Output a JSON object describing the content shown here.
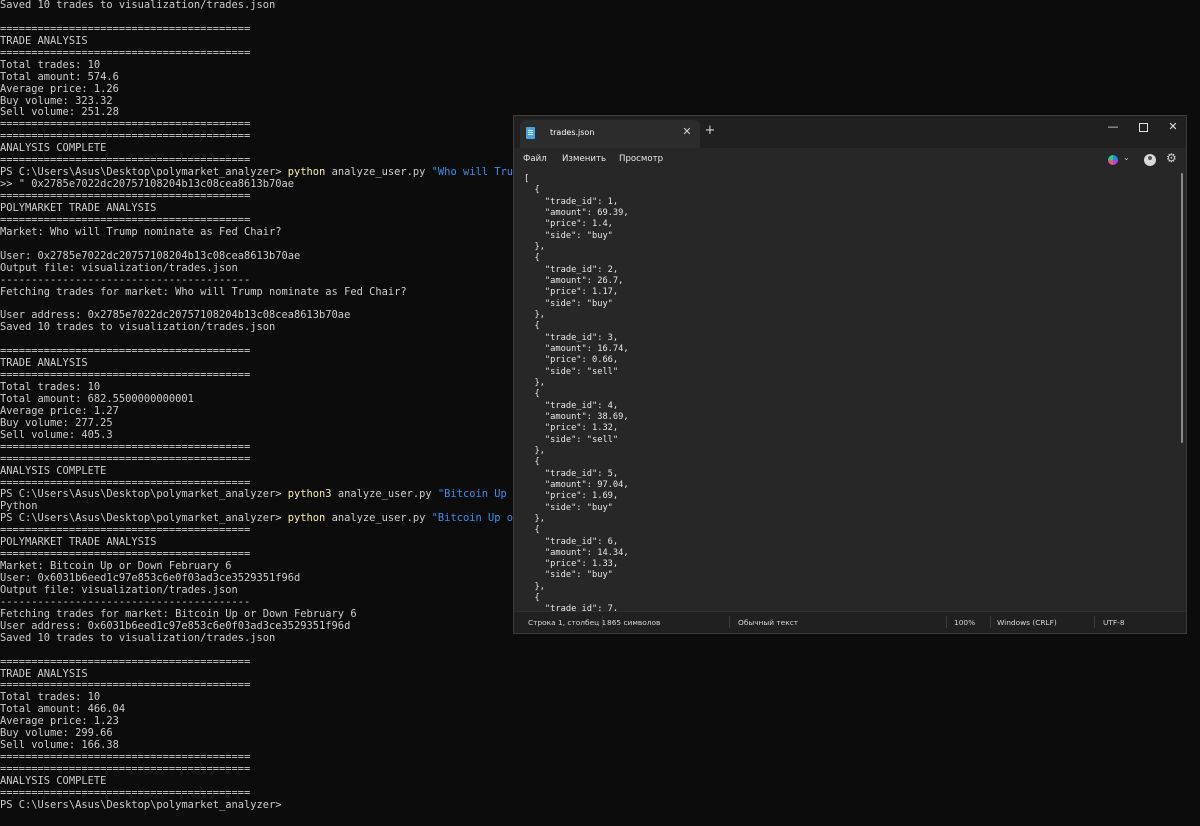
{
  "terminal": {
    "lines": [
      {
        "t": "Saved 10 trades to visualization/trades.json"
      },
      {
        "t": ""
      },
      {
        "t": "========================================"
      },
      {
        "t": "TRADE ANALYSIS"
      },
      {
        "t": "========================================"
      },
      {
        "t": "Total trades: 10"
      },
      {
        "t": "Total amount: 574.6"
      },
      {
        "t": "Average price: 1.26"
      },
      {
        "t": "Buy volume: 323.32"
      },
      {
        "t": "Sell volume: 251.28"
      },
      {
        "t": "========================================"
      },
      {
        "t": "========================================"
      },
      {
        "t": "ANALYSIS COMPLETE"
      },
      {
        "t": "========================================"
      },
      {
        "t": "PS C:\\Users\\Asus\\Desktop\\polymarket_analyzer> ",
        "cmd": "python",
        "rest": " analyze_user.py ",
        "str": "\"Who will Trump nomina"
      },
      {
        "t": ">> \" 0x2785e7022dc20757108204b13c08cea8613b70ae"
      },
      {
        "t": "========================================"
      },
      {
        "t": "POLYMARKET TRADE ANALYSIS"
      },
      {
        "t": "========================================"
      },
      {
        "t": "Market: Who will Trump nominate as Fed Chair?"
      },
      {
        "t": ""
      },
      {
        "t": "User: 0x2785e7022dc20757108204b13c08cea8613b70ae"
      },
      {
        "t": "Output file: visualization/trades.json"
      },
      {
        "t": "----------------------------------------"
      },
      {
        "t": "Fetching trades for market: Who will Trump nominate as Fed Chair?"
      },
      {
        "t": ""
      },
      {
        "t": "User address: 0x2785e7022dc20757108204b13c08cea8613b70ae"
      },
      {
        "t": "Saved 10 trades to visualization/trades.json"
      },
      {
        "t": ""
      },
      {
        "t": "========================================"
      },
      {
        "t": "TRADE ANALYSIS"
      },
      {
        "t": "========================================"
      },
      {
        "t": "Total trades: 10"
      },
      {
        "t": "Total amount: 682.5500000000001"
      },
      {
        "t": "Average price: 1.27"
      },
      {
        "t": "Buy volume: 277.25"
      },
      {
        "t": "Sell volume: 405.3"
      },
      {
        "t": "========================================"
      },
      {
        "t": "========================================"
      },
      {
        "t": "ANALYSIS COMPLETE"
      },
      {
        "t": "========================================"
      },
      {
        "t": "PS C:\\Users\\Asus\\Desktop\\polymarket_analyzer> ",
        "cmd": "python3",
        "rest": " analyze_user.py ",
        "str": "\"Bitcoin Up or Down F"
      },
      {
        "t": "Python"
      },
      {
        "t": "PS C:\\Users\\Asus\\Desktop\\polymarket_analyzer> ",
        "cmd": "python",
        "rest": " analyze_user.py ",
        "str": "\"Bitcoin Up or Down Fe"
      },
      {
        "t": "========================================"
      },
      {
        "t": "POLYMARKET TRADE ANALYSIS"
      },
      {
        "t": "========================================"
      },
      {
        "t": "Market: Bitcoin Up or Down February 6"
      },
      {
        "t": "User: 0x6031b6eed1c97e853c6e0f03ad3ce3529351f96d"
      },
      {
        "t": "Output file: visualization/trades.json"
      },
      {
        "t": "----------------------------------------"
      },
      {
        "t": "Fetching trades for market: Bitcoin Up or Down February 6"
      },
      {
        "t": "User address: 0x6031b6eed1c97e853c6e0f03ad3ce3529351f96d"
      },
      {
        "t": "Saved 10 trades to visualization/trades.json"
      },
      {
        "t": ""
      },
      {
        "t": "========================================"
      },
      {
        "t": "TRADE ANALYSIS"
      },
      {
        "t": "========================================"
      },
      {
        "t": "Total trades: 10"
      },
      {
        "t": "Total amount: 466.04"
      },
      {
        "t": "Average price: 1.23"
      },
      {
        "t": "Buy volume: 299.66"
      },
      {
        "t": "Sell volume: 166.38"
      },
      {
        "t": "========================================"
      },
      {
        "t": "========================================"
      },
      {
        "t": "ANALYSIS COMPLETE"
      },
      {
        "t": "========================================"
      },
      {
        "t": "PS C:\\Users\\Asus\\Desktop\\polymarket_analyzer>"
      }
    ]
  },
  "notepad": {
    "tab_title": "trades.json",
    "tab_close": "✕",
    "new_tab": "+",
    "window": {
      "minimize": "—",
      "close": "✕"
    },
    "menu": {
      "file": "Файл",
      "edit": "Изменить",
      "view": "Просмотр"
    },
    "icons": {
      "copilot": "copilot-icon",
      "account": "account-icon",
      "settings": "gear-icon"
    },
    "content_lines": [
      "[",
      "  {",
      "    \"trade_id\": 1,",
      "    \"amount\": 69.39,",
      "    \"price\": 1.4,",
      "    \"side\": \"buy\"",
      "  },",
      "  {",
      "    \"trade_id\": 2,",
      "    \"amount\": 26.7,",
      "    \"price\": 1.17,",
      "    \"side\": \"buy\"",
      "  },",
      "  {",
      "    \"trade_id\": 3,",
      "    \"amount\": 16.74,",
      "    \"price\": 0.66,",
      "    \"side\": \"sell\"",
      "  },",
      "  {",
      "    \"trade_id\": 4,",
      "    \"amount\": 38.69,",
      "    \"price\": 1.32,",
      "    \"side\": \"sell\"",
      "  },",
      "  {",
      "    \"trade_id\": 5,",
      "    \"amount\": 97.04,",
      "    \"price\": 1.69,",
      "    \"side\": \"buy\"",
      "  },",
      "  {",
      "    \"trade_id\": 6,",
      "    \"amount\": 14.34,",
      "    \"price\": 1.33,",
      "    \"side\": \"buy\"",
      "  },",
      "  {",
      "    \"trade_id\": 7,"
    ],
    "status": {
      "position": "Строка 1, столбец 1",
      "char_count": "865 символов",
      "format": "Обычный текст",
      "zoom": "100%",
      "line_endings": "Windows (CRLF)",
      "encoding": "UTF-8"
    }
  }
}
